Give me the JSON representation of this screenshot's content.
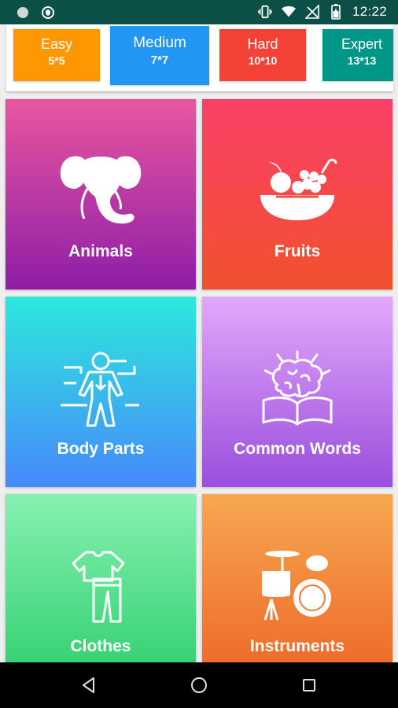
{
  "status_bar": {
    "time": "12:22",
    "icons": [
      "circle-notification-icon",
      "shield-icon",
      "vibrate-icon",
      "wifi-icon",
      "no-signal-icon",
      "battery-icon"
    ]
  },
  "difficulty": {
    "selected": "Medium",
    "levels": [
      {
        "name": "Easy",
        "size": "5*5",
        "color": "#ff9800"
      },
      {
        "name": "Medium",
        "size": "7*7",
        "color": "#2196f3"
      },
      {
        "name": "Hard",
        "size": "10*10",
        "color": "#f44336"
      },
      {
        "name": "Expert",
        "size": "13*13",
        "color": "#009688"
      }
    ]
  },
  "categories": [
    {
      "label": "Animals",
      "icon": "elephant-icon"
    },
    {
      "label": "Fruits",
      "icon": "fruit-bowl-icon"
    },
    {
      "label": "Body Parts",
      "icon": "body-diagram-icon"
    },
    {
      "label": "Common Words",
      "icon": "brain-book-icon"
    },
    {
      "label": "Clothes",
      "icon": "clothes-icon"
    },
    {
      "label": "Instruments",
      "icon": "drum-kit-icon"
    }
  ],
  "nav": {
    "icons": [
      "back-icon",
      "home-icon",
      "recents-icon"
    ]
  }
}
